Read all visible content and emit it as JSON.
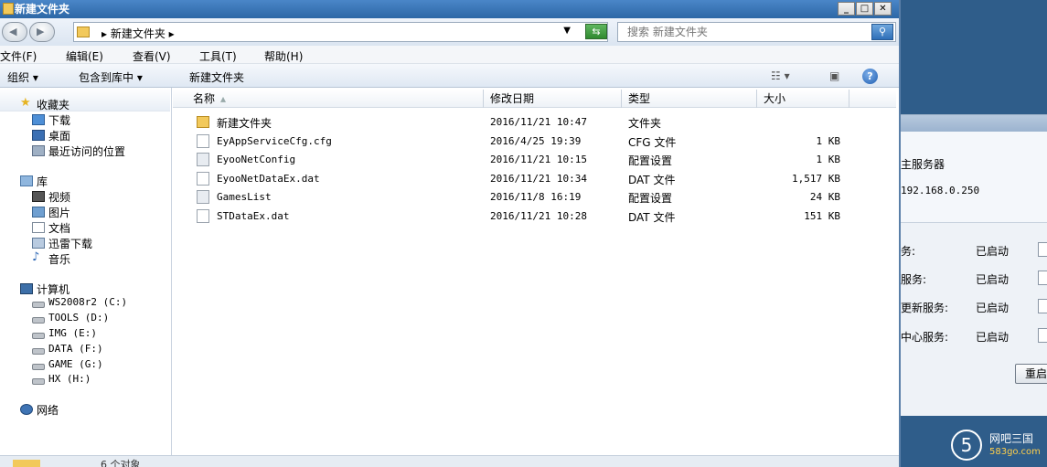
{
  "window": {
    "title": "新建文件夹"
  },
  "address": {
    "path": "▸ 新建文件夹 ▸",
    "search_placeholder": "搜索 新建文件夹"
  },
  "menu": [
    "文件(F)",
    "编辑(E)",
    "查看(V)",
    "工具(T)",
    "帮助(H)"
  ],
  "commands": {
    "organize": "组织 ▾",
    "include_library": "包含到库中 ▾",
    "new_folder": "新建文件夹"
  },
  "nav": {
    "favorites_header": "收藏夹",
    "favorites": [
      "下载",
      "桌面",
      "最近访问的位置"
    ],
    "libraries_header": "库",
    "libraries": [
      "视频",
      "图片",
      "文档",
      "迅雷下载",
      "音乐"
    ],
    "computer_header": "计算机",
    "drives": [
      "WS2008r2 (C:)",
      "TOOLS (D:)",
      "IMG (E:)",
      "DATA (F:)",
      "GAME (G:)",
      "HX (H:)"
    ],
    "network": "网络"
  },
  "columns": {
    "name": "名称",
    "modified": "修改日期",
    "type": "类型",
    "size": "大小"
  },
  "files": [
    {
      "name": "新建文件夹",
      "modified": "2016/11/21 10:47",
      "type": "文件夹",
      "size": "",
      "icon": "folder-icon"
    },
    {
      "name": "EyAppServiceCfg.cfg",
      "modified": "2016/4/25 19:39",
      "type": "CFG 文件",
      "size": "1 KB",
      "icon": "file-icon"
    },
    {
      "name": "EyooNetConfig",
      "modified": "2016/11/21 10:15",
      "type": "配置设置",
      "size": "1 KB",
      "icon": "config-file-icon"
    },
    {
      "name": "EyooNetDataEx.dat",
      "modified": "2016/11/21 10:34",
      "type": "DAT 文件",
      "size": "1,517 KB",
      "icon": "file-icon"
    },
    {
      "name": "GamesList",
      "modified": "2016/11/8 16:19",
      "type": "配置设置",
      "size": "24 KB",
      "icon": "config-file-icon"
    },
    {
      "name": "STDataEx.dat",
      "modified": "2016/11/21 10:28",
      "type": "DAT 文件",
      "size": "151 KB",
      "icon": "file-icon"
    }
  ],
  "status": {
    "text": "6 个对象"
  },
  "service_window": {
    "host_label": "主服务器",
    "host_ip": "192.168.0.250",
    "services": [
      {
        "label": "务:",
        "status": "已启动"
      },
      {
        "label": "服务:",
        "status": "已启动"
      },
      {
        "label": "更新服务:",
        "status": "已启动"
      },
      {
        "label": "中心服务:",
        "status": "已启动"
      }
    ],
    "restart_label": "重启"
  },
  "watermark": {
    "logo": "5",
    "title": "网吧三国",
    "site": "583go.com"
  }
}
